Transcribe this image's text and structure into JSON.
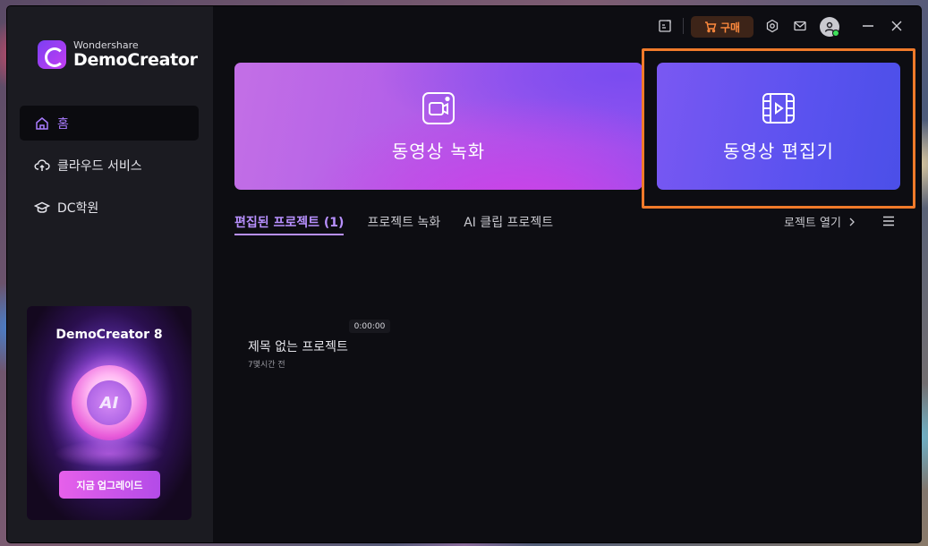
{
  "app": {
    "brand": "Wondershare",
    "product": "DemoCreator"
  },
  "sidebar": {
    "items": [
      {
        "label": "홈",
        "icon": "home-icon",
        "active": true
      },
      {
        "label": "클라우드 서비스",
        "icon": "cloud-upload-icon",
        "active": false
      },
      {
        "label": "DC학원",
        "icon": "graduation-cap-icon",
        "active": false
      }
    ],
    "promo": {
      "title": "DemoCreator 8",
      "orb_text": "AI",
      "button_label": "지금 업그레이드"
    }
  },
  "titlebar": {
    "buy_label": "구매",
    "icons": [
      "feedback-icon",
      "cart-icon",
      "settings-hex-icon",
      "mail-icon",
      "avatar-icon",
      "minimize-icon",
      "close-icon"
    ],
    "status_color": "#3ee05a"
  },
  "hero": {
    "record_label": "동영상 녹화",
    "edit_label": "동영상 편집기",
    "highlight_color": "#f07a2a"
  },
  "tabs": [
    {
      "label": "편집된 프로젝트 (1)",
      "active": true
    },
    {
      "label": "프로젝트 녹화",
      "active": false
    },
    {
      "label": "AI 클립 프로젝트",
      "active": false
    }
  ],
  "open_project_label": "로젝트 열기",
  "projects": [
    {
      "duration": "0:00:00",
      "title": "제목 없는 프로젝트",
      "time": "7몇시간 전"
    }
  ],
  "colors": {
    "accent": "#a97cff",
    "buy": "#ff8a3d"
  }
}
